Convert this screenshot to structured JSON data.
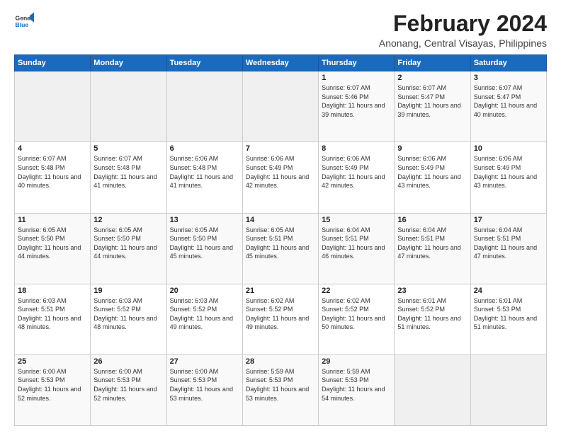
{
  "header": {
    "logo_line1": "General",
    "logo_line2": "Blue",
    "title": "February 2024",
    "subtitle": "Anonang, Central Visayas, Philippines"
  },
  "calendar": {
    "days_of_week": [
      "Sunday",
      "Monday",
      "Tuesday",
      "Wednesday",
      "Thursday",
      "Friday",
      "Saturday"
    ],
    "weeks": [
      [
        {
          "day": "",
          "sunrise": "",
          "sunset": "",
          "daylight": "",
          "empty": true
        },
        {
          "day": "",
          "sunrise": "",
          "sunset": "",
          "daylight": "",
          "empty": true
        },
        {
          "day": "",
          "sunrise": "",
          "sunset": "",
          "daylight": "",
          "empty": true
        },
        {
          "day": "",
          "sunrise": "",
          "sunset": "",
          "daylight": "",
          "empty": true
        },
        {
          "day": "1",
          "sunrise": "6:07 AM",
          "sunset": "5:46 PM",
          "daylight": "11 hours and 39 minutes."
        },
        {
          "day": "2",
          "sunrise": "6:07 AM",
          "sunset": "5:47 PM",
          "daylight": "11 hours and 39 minutes."
        },
        {
          "day": "3",
          "sunrise": "6:07 AM",
          "sunset": "5:47 PM",
          "daylight": "11 hours and 40 minutes."
        }
      ],
      [
        {
          "day": "4",
          "sunrise": "6:07 AM",
          "sunset": "5:48 PM",
          "daylight": "11 hours and 40 minutes."
        },
        {
          "day": "5",
          "sunrise": "6:07 AM",
          "sunset": "5:48 PM",
          "daylight": "11 hours and 41 minutes."
        },
        {
          "day": "6",
          "sunrise": "6:06 AM",
          "sunset": "5:48 PM",
          "daylight": "11 hours and 41 minutes."
        },
        {
          "day": "7",
          "sunrise": "6:06 AM",
          "sunset": "5:49 PM",
          "daylight": "11 hours and 42 minutes."
        },
        {
          "day": "8",
          "sunrise": "6:06 AM",
          "sunset": "5:49 PM",
          "daylight": "11 hours and 42 minutes."
        },
        {
          "day": "9",
          "sunrise": "6:06 AM",
          "sunset": "5:49 PM",
          "daylight": "11 hours and 43 minutes."
        },
        {
          "day": "10",
          "sunrise": "6:06 AM",
          "sunset": "5:49 PM",
          "daylight": "11 hours and 43 minutes."
        }
      ],
      [
        {
          "day": "11",
          "sunrise": "6:05 AM",
          "sunset": "5:50 PM",
          "daylight": "11 hours and 44 minutes."
        },
        {
          "day": "12",
          "sunrise": "6:05 AM",
          "sunset": "5:50 PM",
          "daylight": "11 hours and 44 minutes."
        },
        {
          "day": "13",
          "sunrise": "6:05 AM",
          "sunset": "5:50 PM",
          "daylight": "11 hours and 45 minutes."
        },
        {
          "day": "14",
          "sunrise": "6:05 AM",
          "sunset": "5:51 PM",
          "daylight": "11 hours and 45 minutes."
        },
        {
          "day": "15",
          "sunrise": "6:04 AM",
          "sunset": "5:51 PM",
          "daylight": "11 hours and 46 minutes."
        },
        {
          "day": "16",
          "sunrise": "6:04 AM",
          "sunset": "5:51 PM",
          "daylight": "11 hours and 47 minutes."
        },
        {
          "day": "17",
          "sunrise": "6:04 AM",
          "sunset": "5:51 PM",
          "daylight": "11 hours and 47 minutes."
        }
      ],
      [
        {
          "day": "18",
          "sunrise": "6:03 AM",
          "sunset": "5:51 PM",
          "daylight": "11 hours and 48 minutes."
        },
        {
          "day": "19",
          "sunrise": "6:03 AM",
          "sunset": "5:52 PM",
          "daylight": "11 hours and 48 minutes."
        },
        {
          "day": "20",
          "sunrise": "6:03 AM",
          "sunset": "5:52 PM",
          "daylight": "11 hours and 49 minutes."
        },
        {
          "day": "21",
          "sunrise": "6:02 AM",
          "sunset": "5:52 PM",
          "daylight": "11 hours and 49 minutes."
        },
        {
          "day": "22",
          "sunrise": "6:02 AM",
          "sunset": "5:52 PM",
          "daylight": "11 hours and 50 minutes."
        },
        {
          "day": "23",
          "sunrise": "6:01 AM",
          "sunset": "5:52 PM",
          "daylight": "11 hours and 51 minutes."
        },
        {
          "day": "24",
          "sunrise": "6:01 AM",
          "sunset": "5:53 PM",
          "daylight": "11 hours and 51 minutes."
        }
      ],
      [
        {
          "day": "25",
          "sunrise": "6:00 AM",
          "sunset": "5:53 PM",
          "daylight": "11 hours and 52 minutes."
        },
        {
          "day": "26",
          "sunrise": "6:00 AM",
          "sunset": "5:53 PM",
          "daylight": "11 hours and 52 minutes."
        },
        {
          "day": "27",
          "sunrise": "6:00 AM",
          "sunset": "5:53 PM",
          "daylight": "11 hours and 53 minutes."
        },
        {
          "day": "28",
          "sunrise": "5:59 AM",
          "sunset": "5:53 PM",
          "daylight": "11 hours and 53 minutes."
        },
        {
          "day": "29",
          "sunrise": "5:59 AM",
          "sunset": "5:53 PM",
          "daylight": "11 hours and 54 minutes."
        },
        {
          "day": "",
          "sunrise": "",
          "sunset": "",
          "daylight": "",
          "empty": true
        },
        {
          "day": "",
          "sunrise": "",
          "sunset": "",
          "daylight": "",
          "empty": true
        }
      ]
    ]
  }
}
